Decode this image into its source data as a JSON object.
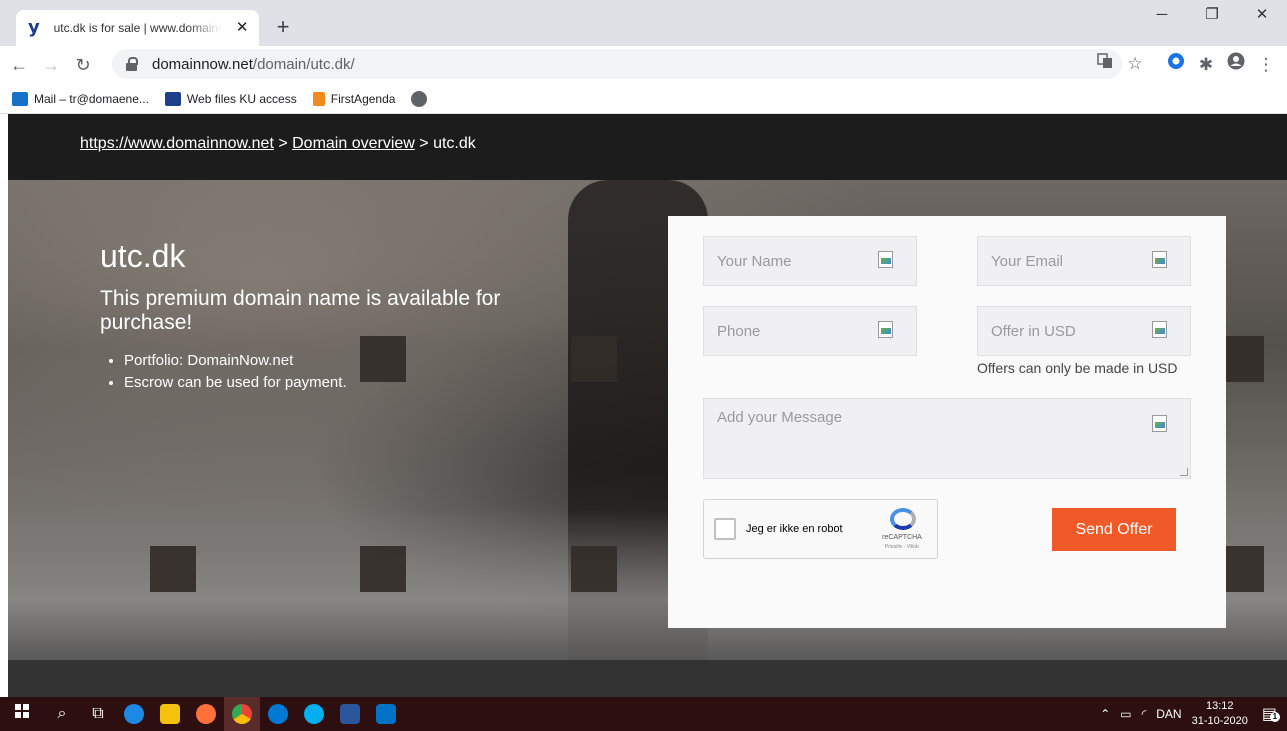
{
  "browser": {
    "tab_title": "utc.dk is for sale | www.domainnow.net",
    "tab_close": "✕",
    "new_tab": "+",
    "url_host": "domainnow.net",
    "url_path": "/domain/utc.dk/",
    "window_controls": [
      "─",
      "❐",
      "✕"
    ]
  },
  "bookmarks": [
    {
      "label": "Mail – tr@domaene...",
      "icon": "outlook-icon"
    },
    {
      "label": "Web files KU access",
      "icon": "ku-icon"
    },
    {
      "label": "FirstAgenda",
      "icon": "firstagenda-icon"
    }
  ],
  "breadcrumb": {
    "home": "https://www.domainnow.net",
    "sep1": " > ",
    "overview": "Domain overview",
    "sep2": " > ",
    "current": "utc.dk"
  },
  "hero": {
    "title": "utc.dk",
    "subtitle": "This premium domain name is available for purchase!",
    "bullets": [
      "Portfolio: DomainNow.net",
      "Escrow can be used for payment."
    ]
  },
  "form": {
    "name_placeholder": "Your Name",
    "email_placeholder": "Your Email",
    "phone_placeholder": "Phone",
    "offer_placeholder": "Offer in USD",
    "offer_note": "Offers can only be made in USD",
    "message_placeholder": "Add your Message",
    "captcha_label": "Jeg er ikke en robot",
    "captcha_brand": "reCAPTCHA",
    "captcha_links": "Privatliv - Vilkår",
    "submit_label": "Send Offer"
  },
  "taskbar": {
    "language": "DAN",
    "time": "13:12",
    "date": "31-10-2020",
    "notifications": "1"
  },
  "colors": {
    "accent": "#f05a28",
    "taskbar": "#2e0f10"
  }
}
